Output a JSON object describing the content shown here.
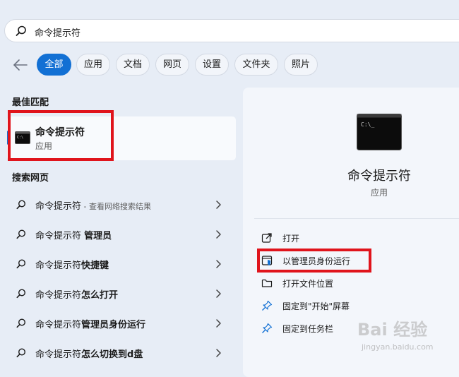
{
  "search": {
    "query": "命令提示符"
  },
  "filters": [
    "全部",
    "应用",
    "文档",
    "网页",
    "设置",
    "文件夹",
    "照片"
  ],
  "sections": {
    "best_match": "最佳匹配",
    "search_web": "搜索网页"
  },
  "best_match": {
    "name": "命令提示符",
    "type": "应用"
  },
  "web_results": [
    {
      "bold": "命令提示符",
      "normal": "",
      "hint": " - 查看网络搜索结果"
    },
    {
      "bold": "",
      "normal": "命令提示符 ",
      "bold2": "管理员"
    },
    {
      "bold": "",
      "normal": "命令提示符",
      "bold2": "快捷键"
    },
    {
      "bold": "",
      "normal": "命令提示符",
      "bold2": "怎么打开"
    },
    {
      "bold": "",
      "normal": "命令提示符",
      "bold2": "管理员身份运行"
    },
    {
      "bold": "",
      "normal": "命令提示符",
      "bold2": "怎么切换到d盘"
    }
  ],
  "detail": {
    "name": "命令提示符",
    "type": "应用",
    "actions": [
      "打开",
      "以管理员身份运行",
      "打开文件位置",
      "固定到\"开始\"屏幕",
      "固定到任务栏"
    ]
  },
  "watermark": {
    "text": "Bai 经验",
    "url": "jingyan.baidu.com"
  },
  "colors": {
    "accent": "#1270d4",
    "highlight": "#e0141c"
  }
}
